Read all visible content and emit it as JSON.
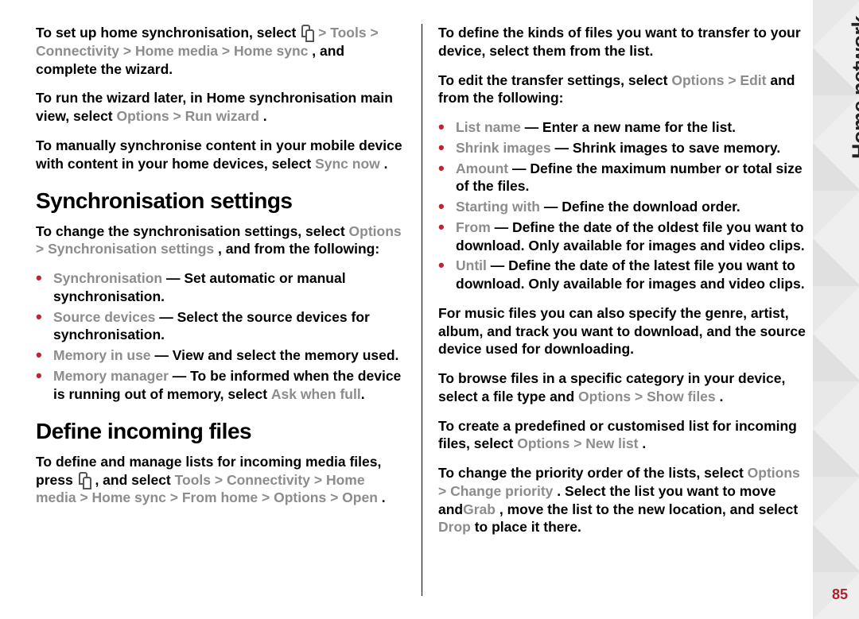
{
  "section": "Home network",
  "pageNumber": "85",
  "left": {
    "p1": {
      "t1": "To set up home synchronisation, select ",
      "nav": [
        "Tools",
        "Connectivity",
        "Home media",
        "Home sync"
      ],
      "t2": ", and complete the wizard."
    },
    "p2": {
      "t1": "To run the wizard later, in Home synchronisation main view, select ",
      "nav": [
        "Options",
        "Run wizard"
      ],
      "t2": "."
    },
    "p3": {
      "t1": "To manually synchronise content in your mobile device with content in your home devices, select ",
      "b": "Sync now",
      "t2": "."
    },
    "h1": "Synchronisation settings",
    "p4": {
      "t1": "To change the synchronisation settings, select ",
      "nav": [
        "Options",
        "Synchronisation settings"
      ],
      "t2": ", and from the following:"
    },
    "list1": [
      {
        "term": "Synchronisation",
        "desc": " — Set automatic or manual synchronisation."
      },
      {
        "term": "Source devices",
        "desc": " — Select the source devices for synchronisation."
      },
      {
        "term": "Memory in use",
        "desc": " — View and select the memory used."
      },
      {
        "term": "Memory manager",
        "desc": " — To be informed when the device is running out of memory, select ",
        "b": "Ask when full",
        "tail": "."
      }
    ],
    "h2": "Define incoming files",
    "p5": {
      "t1": "To define and manage lists for incoming media files, press ",
      "t2": " , and select ",
      "nav": [
        "Tools",
        "Connectivity",
        "Home media",
        "Home sync",
        "From home",
        "Options",
        "Open"
      ],
      "t3": "."
    }
  },
  "right": {
    "p1": "To define the kinds of files you want to transfer to your device, select them from the list.",
    "p2": {
      "t1": "To edit the transfer settings, select ",
      "nav": [
        "Options",
        "Edit"
      ],
      "t2": " and from the following:"
    },
    "list1": [
      {
        "term": "List name",
        "desc": " — Enter a new name for the list."
      },
      {
        "term": "Shrink images",
        "desc": " — Shrink images to save memory."
      },
      {
        "term": "Amount",
        "desc": " — Define the maximum number or total size of the files."
      },
      {
        "term": "Starting with",
        "desc": " — Define the download order."
      },
      {
        "term": "From",
        "desc": " — Define the date of the oldest file you want to download. Only available for images and video clips."
      },
      {
        "term": "Until",
        "desc": " — Define the date of the latest file you want to download. Only available for images and video clips."
      }
    ],
    "p3": "For music files you can also specify the genre, artist, album, and track you want to download, and the source device used for downloading.",
    "p4": {
      "t1": "To browse files in a specific category in your device, select a file type and ",
      "nav": [
        "Options",
        "Show files"
      ],
      "t2": "."
    },
    "p5": {
      "t1": "To create a predefined or customised list for incoming files, select ",
      "nav": [
        "Options",
        "New list"
      ],
      "t2": "."
    },
    "p6": {
      "t1": "To change the priority order of the lists, select ",
      "nav": [
        "Options",
        "Change priority"
      ],
      "t2": ". Select the list you want to move and",
      "b1": "Grab",
      "t3": ", move the list to the new location, and select ",
      "b2": "Drop",
      "t4": " to place it there."
    }
  }
}
